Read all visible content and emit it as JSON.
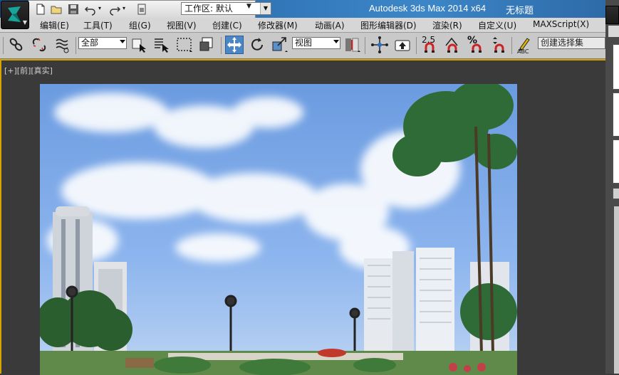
{
  "titlebar": {
    "workspace_label": "工作区: 默认",
    "app_title": "Autodesk 3ds Max  2014 x64",
    "document_title": "无标题"
  },
  "menu": {
    "items": [
      "编辑(E)",
      "工具(T)",
      "组(G)",
      "视图(V)",
      "创建(C)",
      "修改器(M)",
      "动画(A)",
      "图形编辑器(D)",
      "渲染(R)",
      "自定义(U)",
      "MAXScript(X)"
    ]
  },
  "toolbar": {
    "selection_filter": "全部",
    "reference_coord": "视图",
    "snap_2_5": "2.5",
    "named_selection_placeholder": "创建选择集",
    "abc_label": "ABC"
  },
  "viewport": {
    "label": "[+][前][真实]"
  },
  "colors": {
    "accent_active": "#4d86c4",
    "viewport_border": "#d7a400",
    "title_gradient_start": "#1b4f86",
    "title_gradient_end": "#3c86c8"
  }
}
